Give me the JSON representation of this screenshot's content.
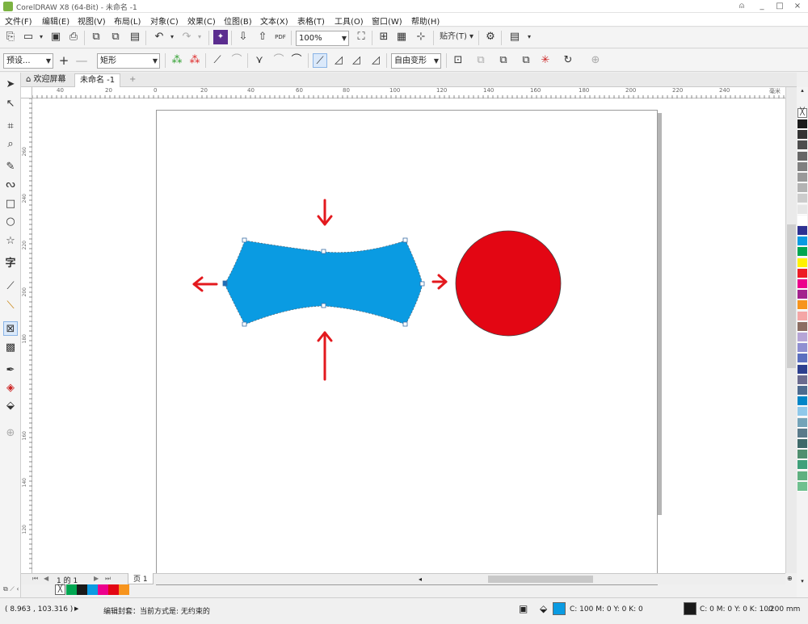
{
  "window": {
    "title": "CorelDRAW X8 (64-Bit) - 未命名 -1",
    "controls": [
      "_",
      "□",
      "×"
    ]
  },
  "menu": [
    "文件(F)",
    "编辑(E)",
    "视图(V)",
    "布局(L)",
    "对象(C)",
    "效果(C)",
    "位图(B)",
    "文本(X)",
    "表格(T)",
    "工具(O)",
    "窗口(W)",
    "帮助(H)"
  ],
  "toolbar1": {
    "zoom": "100%",
    "snap_label": "贴齐(T)",
    "pdf_label": "PDF"
  },
  "toolbar2": {
    "preset": "预设...",
    "shape": "矩形",
    "mode": "自由变形"
  },
  "tabs": [
    {
      "label": "欢迎屏幕",
      "active": false
    },
    {
      "label": "未命名 -1",
      "active": true
    }
  ],
  "ruler_h_ticks": [
    "40",
    "20",
    "0",
    "20",
    "40",
    "60",
    "80",
    "100",
    "120",
    "140",
    "160",
    "180",
    "200",
    "220",
    "240"
  ],
  "ruler_v_ticks": [
    "260",
    "240",
    "220",
    "200",
    "180",
    "160",
    "140",
    "120"
  ],
  "ruler_units": "毫米",
  "page_nav": {
    "current": "1",
    "of": "的",
    "total": "1",
    "page_tab": "页 1"
  },
  "status": {
    "coords": "( 8.963 , 103.316 )",
    "message": "编辑封套：当前方式是: 无约束的",
    "fill": "C: 100 M: 0 Y: 0 K: 0",
    "outline": "C: 0 M: 0 Y: 0 K: 100",
    "outline_width": ".200 mm"
  },
  "colors": {
    "shape_blue": "#0a9be2",
    "circle_red": "#e30613",
    "arrow_red": "#e3191e"
  },
  "palette": [
    "#1a1a1a",
    "#333333",
    "#4d4d4d",
    "#666666",
    "#808080",
    "#999999",
    "#b3b3b3",
    "#cccccc",
    "#e6e6e6",
    "#ffffff",
    "#2e3192",
    "#0a9be2",
    "#00a651",
    "#fff200",
    "#ed1c24",
    "#ec008c",
    "#a3238e",
    "#f7941d",
    "#f4a6a6",
    "#8c6e63",
    "#b6a5d6",
    "#8f8fd1",
    "#5b6fbf",
    "#2d3f8f",
    "#6b6b8f",
    "#4d6b8f",
    "#0085c7",
    "#8fc8ea",
    "#73a3b8",
    "#5a7a8a",
    "#3f6a6a",
    "#4f8f6f",
    "#3fa07a",
    "#5fb080",
    "#6fc08f"
  ],
  "doc_palette": [
    "#00a651",
    "#1a1a1a",
    "#0a9be2",
    "#ec008c",
    "#e30613",
    "#f7941d"
  ]
}
